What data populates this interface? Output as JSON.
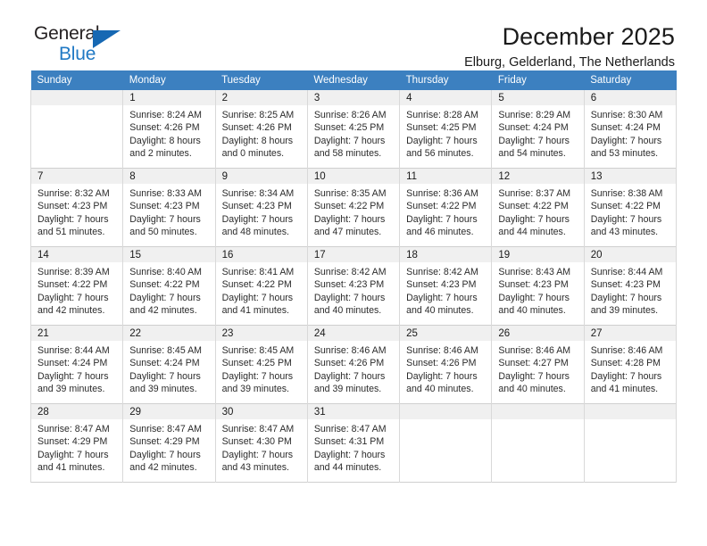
{
  "brand": {
    "name_top": "General",
    "name_bottom": "Blue",
    "triangle_icon": "triangle-icon",
    "accent_color": "#1668b3",
    "text_color": "#231f20"
  },
  "header": {
    "title": "December 2025",
    "subtitle": "Elburg, Gelderland, The Netherlands"
  },
  "theme": {
    "header_bg": "#3c80c0",
    "header_text": "#ffffff",
    "daynum_bg": "#f0f0f0",
    "grid_line": "#cfcfcf"
  },
  "weekday_headers": [
    "Sunday",
    "Monday",
    "Tuesday",
    "Wednesday",
    "Thursday",
    "Friday",
    "Saturday"
  ],
  "weeks": [
    [
      {
        "day": "",
        "sunrise": "",
        "sunset": "",
        "daylight_line1": "",
        "daylight_line2": "",
        "empty": true
      },
      {
        "day": "1",
        "sunrise": "Sunrise: 8:24 AM",
        "sunset": "Sunset: 4:26 PM",
        "daylight_line1": "Daylight: 8 hours",
        "daylight_line2": "and 2 minutes."
      },
      {
        "day": "2",
        "sunrise": "Sunrise: 8:25 AM",
        "sunset": "Sunset: 4:26 PM",
        "daylight_line1": "Daylight: 8 hours",
        "daylight_line2": "and 0 minutes."
      },
      {
        "day": "3",
        "sunrise": "Sunrise: 8:26 AM",
        "sunset": "Sunset: 4:25 PM",
        "daylight_line1": "Daylight: 7 hours",
        "daylight_line2": "and 58 minutes."
      },
      {
        "day": "4",
        "sunrise": "Sunrise: 8:28 AM",
        "sunset": "Sunset: 4:25 PM",
        "daylight_line1": "Daylight: 7 hours",
        "daylight_line2": "and 56 minutes."
      },
      {
        "day": "5",
        "sunrise": "Sunrise: 8:29 AM",
        "sunset": "Sunset: 4:24 PM",
        "daylight_line1": "Daylight: 7 hours",
        "daylight_line2": "and 54 minutes."
      },
      {
        "day": "6",
        "sunrise": "Sunrise: 8:30 AM",
        "sunset": "Sunset: 4:24 PM",
        "daylight_line1": "Daylight: 7 hours",
        "daylight_line2": "and 53 minutes."
      }
    ],
    [
      {
        "day": "7",
        "sunrise": "Sunrise: 8:32 AM",
        "sunset": "Sunset: 4:23 PM",
        "daylight_line1": "Daylight: 7 hours",
        "daylight_line2": "and 51 minutes."
      },
      {
        "day": "8",
        "sunrise": "Sunrise: 8:33 AM",
        "sunset": "Sunset: 4:23 PM",
        "daylight_line1": "Daylight: 7 hours",
        "daylight_line2": "and 50 minutes."
      },
      {
        "day": "9",
        "sunrise": "Sunrise: 8:34 AM",
        "sunset": "Sunset: 4:23 PM",
        "daylight_line1": "Daylight: 7 hours",
        "daylight_line2": "and 48 minutes."
      },
      {
        "day": "10",
        "sunrise": "Sunrise: 8:35 AM",
        "sunset": "Sunset: 4:22 PM",
        "daylight_line1": "Daylight: 7 hours",
        "daylight_line2": "and 47 minutes."
      },
      {
        "day": "11",
        "sunrise": "Sunrise: 8:36 AM",
        "sunset": "Sunset: 4:22 PM",
        "daylight_line1": "Daylight: 7 hours",
        "daylight_line2": "and 46 minutes."
      },
      {
        "day": "12",
        "sunrise": "Sunrise: 8:37 AM",
        "sunset": "Sunset: 4:22 PM",
        "daylight_line1": "Daylight: 7 hours",
        "daylight_line2": "and 44 minutes."
      },
      {
        "day": "13",
        "sunrise": "Sunrise: 8:38 AM",
        "sunset": "Sunset: 4:22 PM",
        "daylight_line1": "Daylight: 7 hours",
        "daylight_line2": "and 43 minutes."
      }
    ],
    [
      {
        "day": "14",
        "sunrise": "Sunrise: 8:39 AM",
        "sunset": "Sunset: 4:22 PM",
        "daylight_line1": "Daylight: 7 hours",
        "daylight_line2": "and 42 minutes."
      },
      {
        "day": "15",
        "sunrise": "Sunrise: 8:40 AM",
        "sunset": "Sunset: 4:22 PM",
        "daylight_line1": "Daylight: 7 hours",
        "daylight_line2": "and 42 minutes."
      },
      {
        "day": "16",
        "sunrise": "Sunrise: 8:41 AM",
        "sunset": "Sunset: 4:22 PM",
        "daylight_line1": "Daylight: 7 hours",
        "daylight_line2": "and 41 minutes."
      },
      {
        "day": "17",
        "sunrise": "Sunrise: 8:42 AM",
        "sunset": "Sunset: 4:23 PM",
        "daylight_line1": "Daylight: 7 hours",
        "daylight_line2": "and 40 minutes."
      },
      {
        "day": "18",
        "sunrise": "Sunrise: 8:42 AM",
        "sunset": "Sunset: 4:23 PM",
        "daylight_line1": "Daylight: 7 hours",
        "daylight_line2": "and 40 minutes."
      },
      {
        "day": "19",
        "sunrise": "Sunrise: 8:43 AM",
        "sunset": "Sunset: 4:23 PM",
        "daylight_line1": "Daylight: 7 hours",
        "daylight_line2": "and 40 minutes."
      },
      {
        "day": "20",
        "sunrise": "Sunrise: 8:44 AM",
        "sunset": "Sunset: 4:23 PM",
        "daylight_line1": "Daylight: 7 hours",
        "daylight_line2": "and 39 minutes."
      }
    ],
    [
      {
        "day": "21",
        "sunrise": "Sunrise: 8:44 AM",
        "sunset": "Sunset: 4:24 PM",
        "daylight_line1": "Daylight: 7 hours",
        "daylight_line2": "and 39 minutes."
      },
      {
        "day": "22",
        "sunrise": "Sunrise: 8:45 AM",
        "sunset": "Sunset: 4:24 PM",
        "daylight_line1": "Daylight: 7 hours",
        "daylight_line2": "and 39 minutes."
      },
      {
        "day": "23",
        "sunrise": "Sunrise: 8:45 AM",
        "sunset": "Sunset: 4:25 PM",
        "daylight_line1": "Daylight: 7 hours",
        "daylight_line2": "and 39 minutes."
      },
      {
        "day": "24",
        "sunrise": "Sunrise: 8:46 AM",
        "sunset": "Sunset: 4:26 PM",
        "daylight_line1": "Daylight: 7 hours",
        "daylight_line2": "and 39 minutes."
      },
      {
        "day": "25",
        "sunrise": "Sunrise: 8:46 AM",
        "sunset": "Sunset: 4:26 PM",
        "daylight_line1": "Daylight: 7 hours",
        "daylight_line2": "and 40 minutes."
      },
      {
        "day": "26",
        "sunrise": "Sunrise: 8:46 AM",
        "sunset": "Sunset: 4:27 PM",
        "daylight_line1": "Daylight: 7 hours",
        "daylight_line2": "and 40 minutes."
      },
      {
        "day": "27",
        "sunrise": "Sunrise: 8:46 AM",
        "sunset": "Sunset: 4:28 PM",
        "daylight_line1": "Daylight: 7 hours",
        "daylight_line2": "and 41 minutes."
      }
    ],
    [
      {
        "day": "28",
        "sunrise": "Sunrise: 8:47 AM",
        "sunset": "Sunset: 4:29 PM",
        "daylight_line1": "Daylight: 7 hours",
        "daylight_line2": "and 41 minutes."
      },
      {
        "day": "29",
        "sunrise": "Sunrise: 8:47 AM",
        "sunset": "Sunset: 4:29 PM",
        "daylight_line1": "Daylight: 7 hours",
        "daylight_line2": "and 42 minutes."
      },
      {
        "day": "30",
        "sunrise": "Sunrise: 8:47 AM",
        "sunset": "Sunset: 4:30 PM",
        "daylight_line1": "Daylight: 7 hours",
        "daylight_line2": "and 43 minutes."
      },
      {
        "day": "31",
        "sunrise": "Sunrise: 8:47 AM",
        "sunset": "Sunset: 4:31 PM",
        "daylight_line1": "Daylight: 7 hours",
        "daylight_line2": "and 44 minutes."
      },
      {
        "day": "",
        "sunrise": "",
        "sunset": "",
        "daylight_line1": "",
        "daylight_line2": "",
        "empty": true
      },
      {
        "day": "",
        "sunrise": "",
        "sunset": "",
        "daylight_line1": "",
        "daylight_line2": "",
        "empty": true
      },
      {
        "day": "",
        "sunrise": "",
        "sunset": "",
        "daylight_line1": "",
        "daylight_line2": "",
        "empty": true
      }
    ]
  ]
}
